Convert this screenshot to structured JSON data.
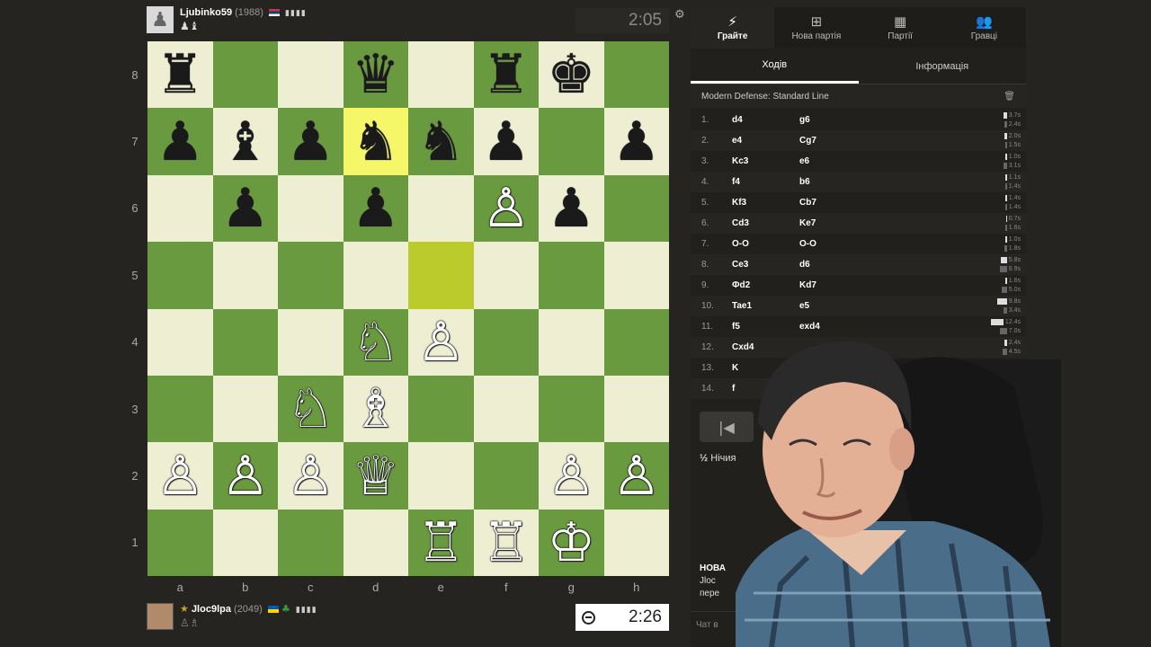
{
  "top_player": {
    "name": "Ljubinko59",
    "rating": "(1988)",
    "flag": "rs",
    "captured": "♟♝"
  },
  "top_clock": "2:05",
  "board": {
    "files": [
      "a",
      "b",
      "c",
      "d",
      "e",
      "f",
      "g",
      "h"
    ],
    "ranks": [
      "8",
      "7",
      "6",
      "5",
      "4",
      "3",
      "2",
      "1"
    ],
    "squares": [
      [
        "♜",
        "",
        "",
        "♛",
        "",
        "♜",
        "♚",
        ""
      ],
      [
        "♟",
        "♝",
        "♟",
        "♞",
        "♞",
        "♟",
        "",
        "♟"
      ],
      [
        "",
        "♟",
        "",
        "♟",
        "",
        "♙",
        "♟",
        ""
      ],
      [
        "",
        "",
        "",
        "",
        "",
        "",
        "",
        ""
      ],
      [
        "",
        "",
        "",
        "♘",
        "♙",
        "",
        "",
        ""
      ],
      [
        "",
        "",
        "♘",
        "♗",
        "",
        "",
        "",
        ""
      ],
      [
        "♙",
        "♙",
        "♙",
        "♕",
        "",
        "",
        "♙",
        "♙"
      ],
      [
        "",
        "",
        "",
        "",
        "♖",
        "♖",
        "♔",
        ""
      ]
    ],
    "colors": [
      [
        "b",
        "",
        "",
        "b",
        "",
        "b",
        "b",
        ""
      ],
      [
        "b",
        "b",
        "b",
        "b",
        "b",
        "b",
        "",
        "b"
      ],
      [
        "",
        "b",
        "",
        "b",
        "",
        "w",
        "b",
        ""
      ],
      [
        "",
        "",
        "",
        "",
        "",
        "",
        "",
        ""
      ],
      [
        "",
        "",
        "",
        "w",
        "w",
        "",
        "",
        ""
      ],
      [
        "",
        "",
        "w",
        "w",
        "",
        "",
        "",
        ""
      ],
      [
        "w",
        "w",
        "w",
        "w",
        "",
        "",
        "w",
        "w"
      ],
      [
        "",
        "",
        "",
        "",
        "w",
        "w",
        "w",
        ""
      ]
    ],
    "highlight_from": "e5",
    "highlight_to": "d7"
  },
  "bottom_player": {
    "name": "Jloc9lpa",
    "rating": "(2049)",
    "flag": "ua",
    "captured": "♙♗"
  },
  "bottom_clock": "2:26",
  "nav": [
    {
      "icon": "⚡",
      "label": "Грайте",
      "name": "play"
    },
    {
      "icon": "⊞",
      "label": "Нова партія",
      "name": "new-game"
    },
    {
      "icon": "▦",
      "label": "Партії",
      "name": "games"
    },
    {
      "icon": "👥",
      "label": "Гравці",
      "name": "players"
    }
  ],
  "subtabs": [
    "Ходів",
    "Інформація"
  ],
  "opening": "Modern Defense: Standard Line",
  "moves": [
    {
      "n": "1.",
      "w": "d4",
      "b": "g6",
      "tw": "3.7s",
      "tb": "2.4s",
      "ww": 4,
      "wb": 3
    },
    {
      "n": "2.",
      "w": "e4",
      "b": "Cg7",
      "tw": "2.0s",
      "tb": "1.5s",
      "ww": 3,
      "wb": 2
    },
    {
      "n": "3.",
      "w": "Kc3",
      "b": "e6",
      "tw": "1.0s",
      "tb": "3.1s",
      "ww": 2,
      "wb": 4
    },
    {
      "n": "4.",
      "w": "f4",
      "b": "b6",
      "tw": "1.1s",
      "tb": "1.4s",
      "ww": 2,
      "wb": 2
    },
    {
      "n": "5.",
      "w": "Kf3",
      "b": "Cb7",
      "tw": "1.4s",
      "tb": "1.4s",
      "ww": 2,
      "wb": 2
    },
    {
      "n": "6.",
      "w": "Cd3",
      "b": "Ke7",
      "tw": "0.7s",
      "tb": "1.6s",
      "ww": 1,
      "wb": 2
    },
    {
      "n": "7.",
      "w": "O-O",
      "b": "O-O",
      "tw": "1.0s",
      "tb": "1.8s",
      "ww": 2,
      "wb": 3
    },
    {
      "n": "8.",
      "w": "Ce3",
      "b": "d6",
      "tw": "5.8s",
      "tb": "6.9s",
      "ww": 7,
      "wb": 8
    },
    {
      "n": "9.",
      "w": "Фd2",
      "b": "Kd7",
      "tw": "1.6s",
      "tb": "5.0s",
      "ww": 2,
      "wb": 6
    },
    {
      "n": "10.",
      "w": "Tae1",
      "b": "e5",
      "tw": "9.8s",
      "tb": "3.4s",
      "ww": 11,
      "wb": 4
    },
    {
      "n": "11.",
      "w": "f5",
      "b": "exd4",
      "tw": "12.4s",
      "tb": "7.0s",
      "ww": 14,
      "wb": 8
    },
    {
      "n": "12.",
      "w": "Cxd4",
      "b": "",
      "tw": "2.4s",
      "tb": "4.5s",
      "ww": 3,
      "wb": 5
    },
    {
      "n": "13.",
      "w": "K",
      "b": "",
      "tw": "2.4s",
      "tb": "4.5s",
      "ww": 3,
      "wb": 5
    },
    {
      "n": "14.",
      "w": "f",
      "b": "",
      "tw": "3s",
      "tb": "8.4s",
      "ww": 4,
      "wb": 20
    }
  ],
  "controls": [
    "|◀",
    "◀",
    "▶",
    "▶|"
  ],
  "draw_label": "Нічия",
  "draw_icon": "½",
  "chat": {
    "title": "НОВА",
    "line1": "Jloc",
    "line2": "пере"
  },
  "chat_placeholder": "Чат в"
}
